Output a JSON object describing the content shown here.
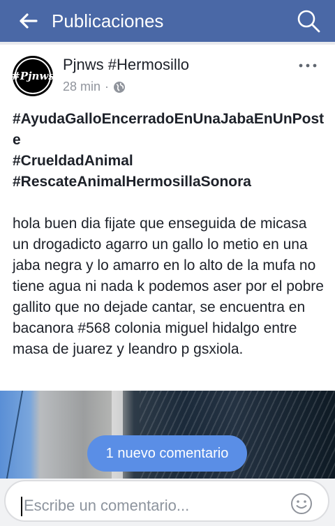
{
  "header": {
    "title": "Publicaciones",
    "back_icon": "arrow-left-icon",
    "search_icon": "search-icon",
    "background": "#4a68a6"
  },
  "post": {
    "author": "Pjnws #Hermosillo",
    "avatar_text": "#Pjnws",
    "time": "28 min",
    "separator": "·",
    "privacy_icon": "globe-icon",
    "more_icon": "more-horizontal-icon",
    "hashtags": [
      "#AyudaGalloEncerradoEnUnaJabaEnUnPoste",
      "#CrueldadAnimal",
      "#RescateAnimalHermosillaSonora"
    ],
    "body": "hola buen dia fijate que enseguida de micasa un drogadicto agarro un gallo lo metio en una jaba negra y lo amarro en lo alto de la mufa no tiene agua ni nada k podemos aser por el pobre gallito que no dejade cantar, se encuentra en bacanora #568 colonia miguel hidalgo entre masa de juarez y leandro p gsxiola."
  },
  "new_comment_toast": "1 nuevo comentario",
  "composer": {
    "placeholder": "Escribe un comentario...",
    "emoji_icon": "smiley-icon"
  }
}
